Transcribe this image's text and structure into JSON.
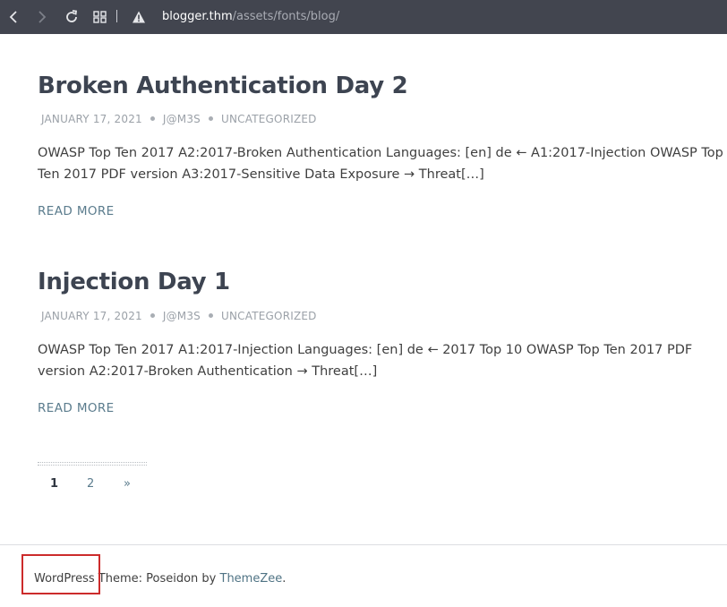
{
  "browser": {
    "url_host": "blogger.thm",
    "url_path": "/assets/fonts/blog/"
  },
  "posts": [
    {
      "title": "Broken Authentication Day 2",
      "date": "JANUARY 17, 2021",
      "author": "J@M3S",
      "category": "UNCATEGORIZED",
      "excerpt_line1": "OWASP Top Ten 2017 A2:2017-Broken Authentication Languages: [en] de ← A1:2017-Injection OWASP Top",
      "excerpt_line2": "Ten 2017 PDF version A3:2017-Sensitive Data Exposure → Threat[…]",
      "read_more": "READ MORE"
    },
    {
      "title": "Injection Day 1",
      "date": "JANUARY 17, 2021",
      "author": "J@M3S",
      "category": "UNCATEGORIZED",
      "excerpt_line1": "OWASP Top Ten 2017 A1:2017-Injection Languages: [en] de ← 2017 Top 10 OWASP Top Ten 2017 PDF",
      "excerpt_line2": "version  A2:2017-Broken Authentication → Threat[…]",
      "read_more": "READ MORE"
    }
  ],
  "pagination": {
    "current": "1",
    "next_page": "2",
    "next": "»"
  },
  "footer": {
    "wordpress": "WordPress",
    "theme_text": " Theme: Poseidon by ",
    "themezee": "ThemeZee",
    "period": "."
  },
  "icons": {
    "back": "chevron-left-icon",
    "forward": "chevron-right-icon",
    "reload": "reload-icon",
    "grid": "grid-icon",
    "warning": "warning-icon"
  },
  "colors": {
    "toolbar": "#42454f",
    "title": "#3d4451",
    "link": "#5b7c8d",
    "highlight": "#cc2b2b"
  }
}
